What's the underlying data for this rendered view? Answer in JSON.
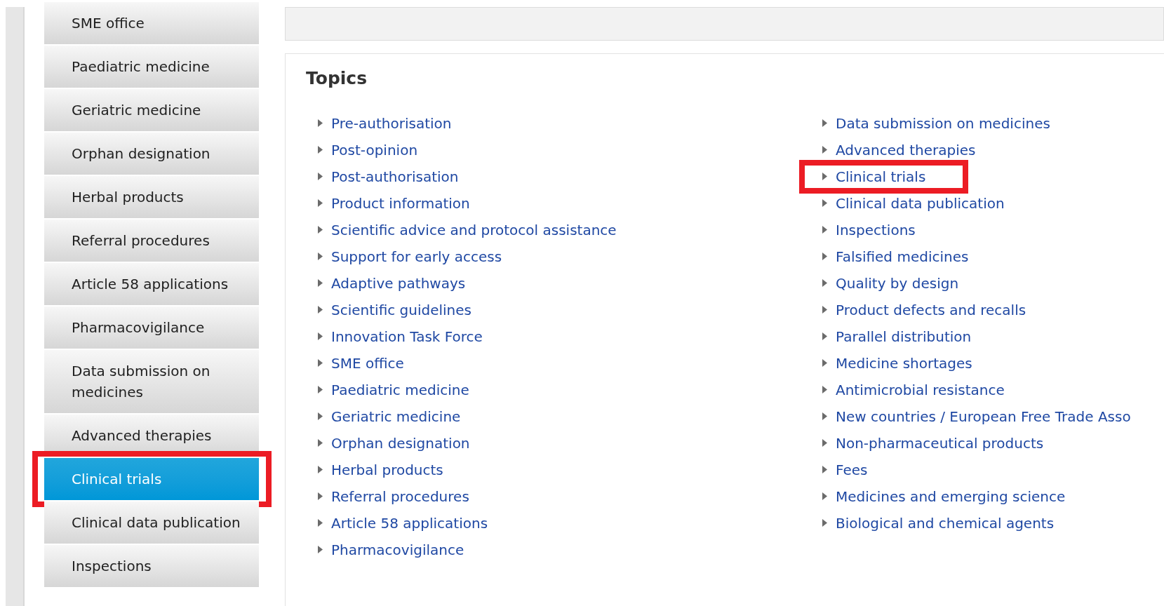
{
  "sidebar": {
    "items": [
      {
        "label": "SME office",
        "selected": false,
        "highlighted": false
      },
      {
        "label": "Paediatric medicine",
        "selected": false,
        "highlighted": false
      },
      {
        "label": "Geriatric medicine",
        "selected": false,
        "highlighted": false
      },
      {
        "label": "Orphan designation",
        "selected": false,
        "highlighted": false
      },
      {
        "label": "Herbal products",
        "selected": false,
        "highlighted": false
      },
      {
        "label": "Referral procedures",
        "selected": false,
        "highlighted": false
      },
      {
        "label": "Article 58 applications",
        "selected": false,
        "highlighted": false
      },
      {
        "label": "Pharmacovigilance",
        "selected": false,
        "highlighted": false
      },
      {
        "label": "Data submission on medicines",
        "selected": false,
        "highlighted": false
      },
      {
        "label": "Advanced therapies",
        "selected": false,
        "highlighted": false
      },
      {
        "label": "Clinical trials",
        "selected": true,
        "highlighted": true
      },
      {
        "label": "Clinical data publication",
        "selected": false,
        "highlighted": false
      },
      {
        "label": "Inspections",
        "selected": false,
        "highlighted": false
      }
    ]
  },
  "topics": {
    "title": "Topics",
    "columns": [
      [
        {
          "label": "Pre-authorisation",
          "highlighted": false
        },
        {
          "label": "Post-opinion",
          "highlighted": false
        },
        {
          "label": "Post-authorisation",
          "highlighted": false
        },
        {
          "label": "Product information",
          "highlighted": false
        },
        {
          "label": "Scientific advice and protocol assistance",
          "highlighted": false
        },
        {
          "label": "Support for early access",
          "highlighted": false
        },
        {
          "label": "Adaptive pathways",
          "highlighted": false
        },
        {
          "label": "Scientific guidelines",
          "highlighted": false
        },
        {
          "label": "Innovation Task Force",
          "highlighted": false
        },
        {
          "label": "SME office",
          "highlighted": false
        },
        {
          "label": "Paediatric medicine",
          "highlighted": false
        },
        {
          "label": "Geriatric medicine",
          "highlighted": false
        },
        {
          "label": "Orphan designation",
          "highlighted": false
        },
        {
          "label": "Herbal products",
          "highlighted": false
        },
        {
          "label": "Referral procedures",
          "highlighted": false
        },
        {
          "label": "Article 58 applications",
          "highlighted": false
        },
        {
          "label": "Pharmacovigilance",
          "highlighted": false
        }
      ],
      [
        {
          "label": "Data submission on medicines",
          "highlighted": false
        },
        {
          "label": "Advanced therapies",
          "highlighted": false
        },
        {
          "label": "Clinical trials",
          "highlighted": true
        },
        {
          "label": "Clinical data publication",
          "highlighted": false
        },
        {
          "label": "Inspections",
          "highlighted": false
        },
        {
          "label": "Falsified medicines",
          "highlighted": false
        },
        {
          "label": "Quality by design",
          "highlighted": false
        },
        {
          "label": "Product defects and recalls",
          "highlighted": false
        },
        {
          "label": "Parallel distribution",
          "highlighted": false
        },
        {
          "label": "Medicine shortages",
          "highlighted": false
        },
        {
          "label": "Antimicrobial resistance",
          "highlighted": false
        },
        {
          "label": "New countries / European Free Trade Asso",
          "highlighted": false
        },
        {
          "label": "Non-pharmaceutical products",
          "highlighted": false
        },
        {
          "label": "Fees",
          "highlighted": false
        },
        {
          "label": "Medicines and emerging science",
          "highlighted": false
        },
        {
          "label": "Biological and chemical agents",
          "highlighted": false
        }
      ]
    ]
  }
}
